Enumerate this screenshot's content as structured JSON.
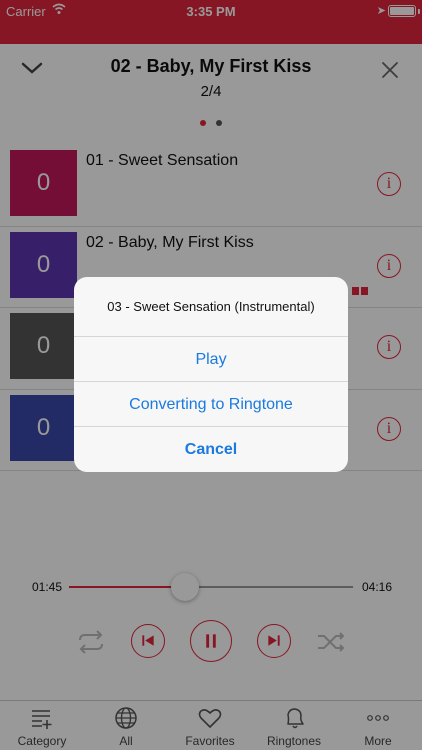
{
  "status_bar": {
    "carrier": "Carrier",
    "time": "3:35 PM"
  },
  "header": {
    "title": "02 - Baby, My First Kiss",
    "counter": "2/4"
  },
  "page_dots": [
    {
      "active": true
    },
    {
      "active": false
    }
  ],
  "tracks": [
    {
      "title": "01 - Sweet Sensation",
      "thumb_label": "0",
      "color": "#c2185b"
    },
    {
      "title": "02 - Baby, My First Kiss",
      "thumb_label": "0",
      "color": "#5e35b1"
    },
    {
      "title": "",
      "thumb_label": "0",
      "color": "#555555"
    },
    {
      "title": "",
      "thumb_label": "0",
      "color": "#3949ab"
    }
  ],
  "info_label": "i",
  "player": {
    "elapsed": "01:45",
    "duration": "04:16",
    "progress_fraction": 0.41
  },
  "tabs": [
    {
      "label": "Category",
      "icon": "category-icon"
    },
    {
      "label": "All",
      "icon": "globe-icon"
    },
    {
      "label": "Favorites",
      "icon": "heart-icon"
    },
    {
      "label": "Ringtones",
      "icon": "bell-icon"
    },
    {
      "label": "More",
      "icon": "more-icon"
    }
  ],
  "dialog": {
    "title": "03 - Sweet Sensation (Instrumental)",
    "actions": [
      "Play",
      "Converting to Ringtone",
      "Cancel"
    ]
  },
  "colors": {
    "accent": "#e2263d",
    "dialog_action": "#1a7ae0"
  }
}
